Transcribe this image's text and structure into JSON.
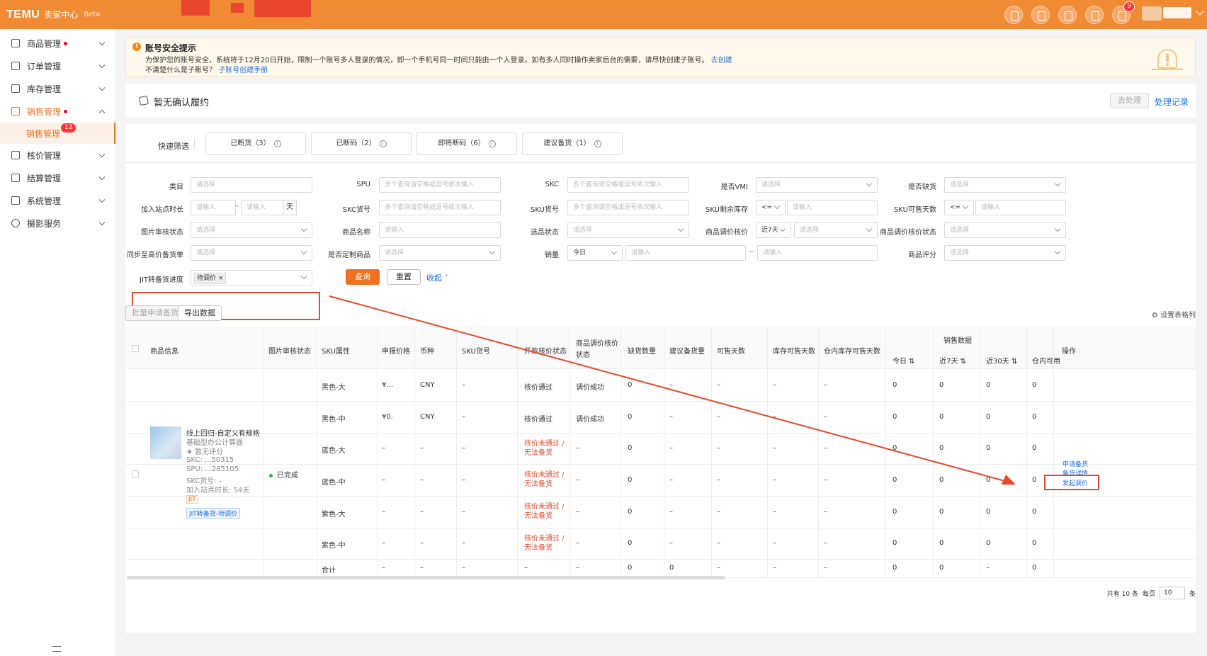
{
  "topbar": {
    "logo": "TEMU",
    "subtitle": "卖家中心",
    "beta": "Beta",
    "notif_count": "9"
  },
  "sidebar": {
    "items": [
      {
        "label": "商品管理"
      },
      {
        "label": "订单管理"
      },
      {
        "label": "库存管理"
      },
      {
        "label": "销售管理"
      },
      {
        "label": "核价管理"
      },
      {
        "label": "结算管理"
      },
      {
        "label": "系统管理"
      },
      {
        "label": "摄影服务"
      }
    ],
    "sub": {
      "label": "销售管理",
      "badge": "12"
    }
  },
  "alert": {
    "title": "账号安全提示",
    "line1": "为保护您的账号安全，系统将于12月20日开始，限制一个账号多人登录的情况，即一个手机号同一时间只能由一个人登录。如有多人同时操作卖家后台的需要，请尽快创建子账号。",
    "line1_link": "去创建",
    "line2": "不清楚什么是子账号？",
    "line2_link": "子账号创建手册"
  },
  "fulfill": {
    "title": "暂无确认履约",
    "btn": "去处理",
    "link": "处理记录"
  },
  "quick": {
    "label": "快速筛选",
    "btns": [
      "已断货（3）",
      "已断码（2）",
      "即将断码（6）",
      "建议备货（1）"
    ]
  },
  "filters": {
    "labels": [
      "类目",
      "SPU",
      "SKC",
      "是否VMI",
      "是否缺货",
      "加入站点时长",
      "SKC货号",
      "SKU货号",
      "SKU剩余库存",
      "SKU可售天数",
      "图片审核状态",
      "商品名称",
      "选品状态",
      "商品调价核价",
      "商品调价核价状态",
      "同步至高价备货单",
      "是否定制商品",
      "销量",
      "商品评分",
      "JIT转备货进度"
    ],
    "ph_select": "请选择",
    "ph_input": "请输入",
    "ph_multi": "多个查询请空格或逗号依次输入",
    "day": "天",
    "tilde": "~",
    "le": "<=",
    "near7": "近7天",
    "today": "今日",
    "jit_tag": "待调价"
  },
  "actions": {
    "query": "查询",
    "reset": "重置",
    "collapse": "收起",
    "batch": "批量申请备货",
    "export": "导出数据",
    "settings": "设置表格列"
  },
  "table": {
    "headers": [
      "商品信息",
      "图片审核状态",
      "SKU属性",
      "申报价格",
      "币种",
      "SKU货号",
      "开款核价状态",
      "商品调价核价状态",
      "缺货数量",
      "建议备货量",
      "可售天数",
      "库存可售天数",
      "仓内库存可售天数",
      "销售数据",
      "今日",
      "近7天",
      "近30天",
      "仓内可用",
      "操作"
    ],
    "product": {
      "name": "线上回归-自定义有规格",
      "sub": "基础型办公计算器",
      "rating": "★ 暂无评分",
      "skc": "SKC: ...50315",
      "spu": "SPU: ...285105",
      "skcno": "SKC货号: –",
      "join": "加入站点时长: 54天",
      "jit": "JIT",
      "jit2": "JIT转备货-待调价"
    },
    "img_status": "已完成",
    "rows": [
      {
        "attr": "黑色-大",
        "price": "¥...",
        "cur": "CNY",
        "skuno": "–",
        "s1": "核价通过",
        "s2": "调价成功",
        "q": "0",
        "sug": "–",
        "sd": "–",
        "ksd": "–",
        "csd": "–",
        "d": "0",
        "w": "0",
        "m": "0",
        "c": "0"
      },
      {
        "attr": "黑色-中",
        "price": "¥0.",
        "cur": "CNY",
        "skuno": "–",
        "s1": "核价通过",
        "s2": "调价成功",
        "q": "0",
        "sug": "–",
        "sd": "–",
        "ksd": "–",
        "csd": "–",
        "d": "0",
        "w": "0",
        "m": "0",
        "c": "0"
      },
      {
        "attr": "蓝色-大",
        "price": "–",
        "cur": "–",
        "skuno": "–",
        "s1": "核价未通过 / 无法备货",
        "s2": "–",
        "q": "0",
        "sug": "–",
        "sd": "–",
        "ksd": "–",
        "csd": "–",
        "d": "0",
        "w": "0",
        "m": "0",
        "c": "0"
      },
      {
        "attr": "蓝色-中",
        "price": "–",
        "cur": "–",
        "skuno": "–",
        "s1": "核价未通过 / 无法备货",
        "s2": "–",
        "q": "0",
        "sug": "–",
        "sd": "–",
        "ksd": "–",
        "csd": "–",
        "d": "0",
        "w": "0",
        "m": "0",
        "c": "0"
      },
      {
        "attr": "紫色-大",
        "price": "–",
        "cur": "–",
        "skuno": "–",
        "s1": "核价未通过 / 无法备货",
        "s2": "–",
        "q": "0",
        "sug": "–",
        "sd": "–",
        "ksd": "–",
        "csd": "–",
        "d": "0",
        "w": "0",
        "m": "0",
        "c": "0"
      },
      {
        "attr": "紫色-中",
        "price": "–",
        "cur": "–",
        "skuno": "–",
        "s1": "核价未通过 / 无法备货",
        "s2": "–",
        "q": "0",
        "sug": "–",
        "sd": "–",
        "ksd": "–",
        "csd": "–",
        "d": "0",
        "w": "0",
        "m": "0",
        "c": "0"
      }
    ],
    "total": {
      "attr": "合计",
      "price": "–",
      "cur": "–",
      "skuno": "–",
      "s1": "–",
      "s2": "–",
      "q": "0",
      "sug": "0",
      "sd": "–",
      "ksd": "–",
      "csd": "–",
      "d": "0",
      "w": "0",
      "m": "–",
      "c": "0"
    },
    "ops": [
      "申请备货",
      "备货详情",
      "发起调价"
    ]
  },
  "pager": {
    "total": "共有 10 条",
    "per": "每页",
    "size": "10",
    "unit": "条"
  }
}
